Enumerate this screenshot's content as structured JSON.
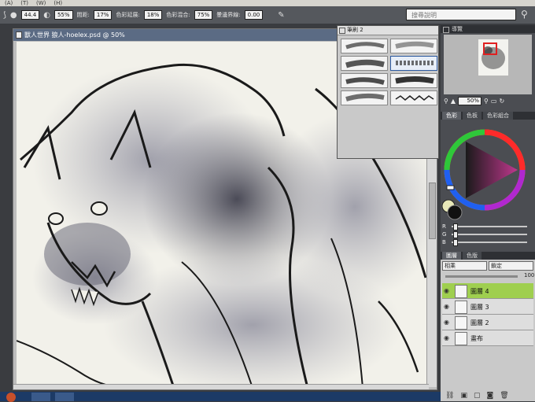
{
  "menubar": {
    "items": [
      "(A)",
      "(T)",
      "(W)",
      "(H)"
    ]
  },
  "toolbar": {
    "size_value": "44.4",
    "opacity_value": "55%",
    "spacing_label": "間距:",
    "spacing_value": "17%",
    "color_extend_label": "色彩延展:",
    "color_extend_value": "18%",
    "color_mix_label": "色彩混合:",
    "color_mix_value": "75%",
    "watercolor_label": "暈邊界線:",
    "watercolor_value": "0.00",
    "search_placeholder": "搜尋說明"
  },
  "canvas": {
    "title": "獸人世界 狼人-hoelex.psd @ 50%"
  },
  "brush_panel": {
    "title": "筆刷 2"
  },
  "navigator": {
    "title": "導覽",
    "zoom_value": "50%"
  },
  "color_panel": {
    "tabs": [
      "色彩",
      "色板",
      "色彩組合"
    ],
    "accent": "#c0388e",
    "rgb_labels": [
      "R",
      "G",
      "B"
    ]
  },
  "layers_panel": {
    "tabs": [
      "圖層",
      "色版"
    ],
    "blend_mode": "相乘",
    "lock_label": "鎖定",
    "opacity_value": "100",
    "layers": [
      {
        "name": "圖層 4",
        "active": true
      },
      {
        "name": "圖層 3",
        "active": false
      },
      {
        "name": "圖層 2",
        "active": false
      },
      {
        "name": "畫布",
        "active": false
      }
    ]
  }
}
